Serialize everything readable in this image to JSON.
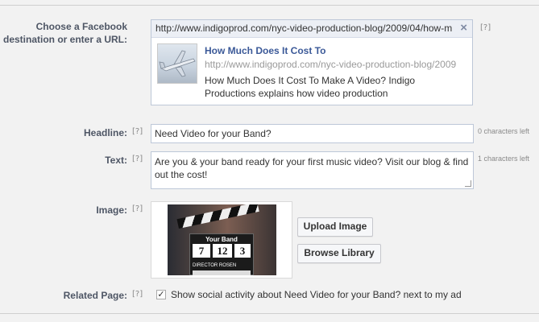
{
  "destination": {
    "label": "Choose a Facebook destination or enter a URL:",
    "help": "[?]",
    "url_value": "http://www.indigoprod.com/nyc-video-production-blog/2009/04/how-m",
    "preview": {
      "title": "How Much Does It Cost To",
      "url": "http://www.indigoprod.com/nyc-video-production-blog/2009",
      "description": "How Much Does It Cost To Make A Video? Indigo Productions explains how video production",
      "thumbnail_icon": "airplane-thumbnail"
    }
  },
  "headline": {
    "label": "Headline:",
    "help": "[?]",
    "value": "Need Video for your Band?",
    "counter": "0 characters left"
  },
  "text": {
    "label": "Text:",
    "help": "[?]",
    "value": "Are you & your band ready for your first music video? Visit our blog & find out the cost!",
    "counter": "1 characters left"
  },
  "image": {
    "label": "Image:",
    "help": "[?]",
    "slate_title": "Your Band",
    "slate_scene": "7",
    "slate_take_a": "12",
    "slate_take_b": "3",
    "slate_director": "DIRECTOR ROSEN",
    "upload_label": "Upload Image",
    "browse_label": "Browse Library"
  },
  "related_page": {
    "label": "Related Page:",
    "help": "[?]",
    "checked": true,
    "checkmark": "✓",
    "text": "Show social activity about Need Video for your Band? next to my ad"
  }
}
